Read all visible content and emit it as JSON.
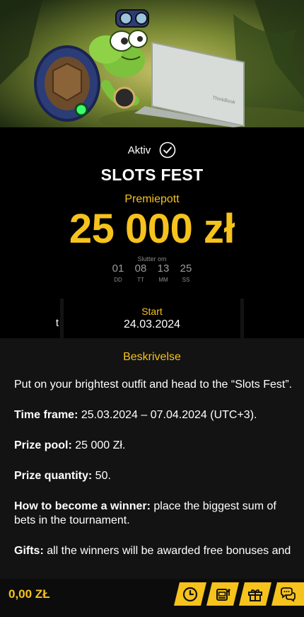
{
  "hero": {
    "laptop_brand": "ThinkBook"
  },
  "status": {
    "label": "Aktiv"
  },
  "tournament": {
    "title": "SLOTS FEST",
    "prize_label": "Premiepott",
    "prize_value": "25 000 zł"
  },
  "countdown": {
    "label": "Slutter om",
    "units": [
      {
        "value": "01",
        "label": "DD"
      },
      {
        "value": "08",
        "label": "TT"
      },
      {
        "value": "13",
        "label": "MM"
      },
      {
        "value": "25",
        "label": "SS"
      }
    ]
  },
  "dates": {
    "left_partial": "t",
    "start_label": "Start",
    "start_value": "24.03.2024"
  },
  "description": {
    "title": "Beskrivelse",
    "intro": "Put on your brightest outfit and head to the “Slots Fest”.",
    "items": [
      {
        "label": "Time frame:",
        "text": " 25.03.2024 – 07.04.2024 (UTC+3)."
      },
      {
        "label": "Prize pool:",
        "text": " 25 000 Zł."
      },
      {
        "label": "Prize quantity:",
        "text": " 50."
      },
      {
        "label": "How to become a winner:",
        "text": " place the biggest sum of bets in the tournament."
      },
      {
        "label": "Gifts:",
        "text": " all the winners will be awarded free bonuses and"
      }
    ]
  },
  "bottom_bar": {
    "balance": "0,00 ZŁ",
    "accent": "#f6c21c",
    "tabs": [
      "clock-icon",
      "slot-machine-icon",
      "gift-icon",
      "chat-icon"
    ]
  }
}
